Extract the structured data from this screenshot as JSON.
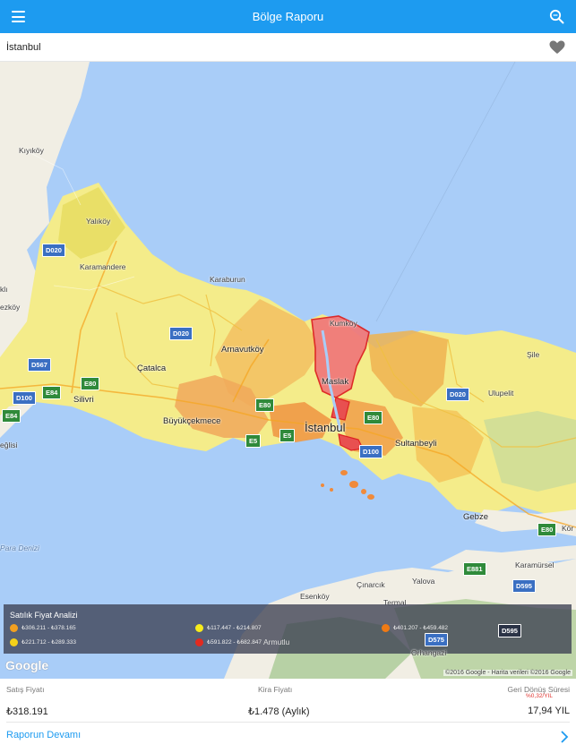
{
  "header": {
    "title": "Bölge Raporu"
  },
  "location": {
    "city": "İstanbul"
  },
  "map": {
    "labels": {
      "kiyikoy": "Kıyıköy",
      "yalikoy": "Yalıköy",
      "karamandere": "Karamandere",
      "karaburun": "Karaburun",
      "arnavutkoy": "Arnavutköy",
      "catalca": "Çatalca",
      "silivri": "Silivri",
      "buyukcekmece": "Büyükçekmece",
      "istanbul": "İstanbul",
      "maslak": "Maslak",
      "kumkoy": "Kumköy",
      "sile": "Şile",
      "ulupelit": "Ulupelit",
      "sultanbeyli": "Sultanbeyli",
      "gebze": "Gebze",
      "korfez": "Kör",
      "esenkoy": "Esenköy",
      "cinarcik": "Çınarcık",
      "yalova": "Yalova",
      "termal": "Termal",
      "karamursel": "Karamürsel",
      "armutlu": "Armutlu",
      "orhangazi": "Orhangazi",
      "ezkoy": "ezköy",
      "kli": "klı",
      "eglisi": "eğlisi",
      "marmara": "Para Denizi",
      "koru": "Koru"
    },
    "roads": {
      "d020a": "D020",
      "d020b": "D020",
      "d020c": "D020",
      "d567": "D567",
      "e80a": "E80",
      "e84a": "E84",
      "d100a": "D100",
      "e84b": "E84",
      "e80b": "E80",
      "e5a": "E5",
      "e5b": "E5",
      "e80c": "E80",
      "d100b": "D100",
      "e80d": "E80",
      "e881": "E881",
      "d595a": "D595",
      "d575": "D575",
      "d595b": "D595"
    },
    "legend": {
      "title": "Satılık Fiyat Analizi",
      "items": [
        {
          "label": "₺306.211 - ₺378.165",
          "color": "#f2a020"
        },
        {
          "label": "₺221.712 - ₺289.333",
          "color": "#f5d21a"
        },
        {
          "label": "₺117.447 - ₺214.807",
          "color": "#f7ec1c"
        },
        {
          "label": "₺591.822 - ₺682.847",
          "color": "#e22a1f"
        },
        {
          "label": "₺401.207 - ₺459.482",
          "color": "#f07a14"
        }
      ]
    },
    "google": "Google",
    "copyright": "©2016 Google - Harita verileri ©2016 Google"
  },
  "stats": {
    "sale_label": "Satış Fiyatı",
    "sale_value": "₺318.191",
    "rent_label": "Kira Fiyatı",
    "rent_value": "₺1.478 (Aylık)",
    "return_label": "Geri Dönüş Süresi",
    "return_change": "%0,32/YIL",
    "return_value": "17,94 YIL"
  },
  "more": {
    "label": "Raporun Devamı"
  },
  "colors": {
    "accent": "#1d9bf0",
    "sea": "#a9cdf8",
    "land": "#f3f0e6"
  }
}
